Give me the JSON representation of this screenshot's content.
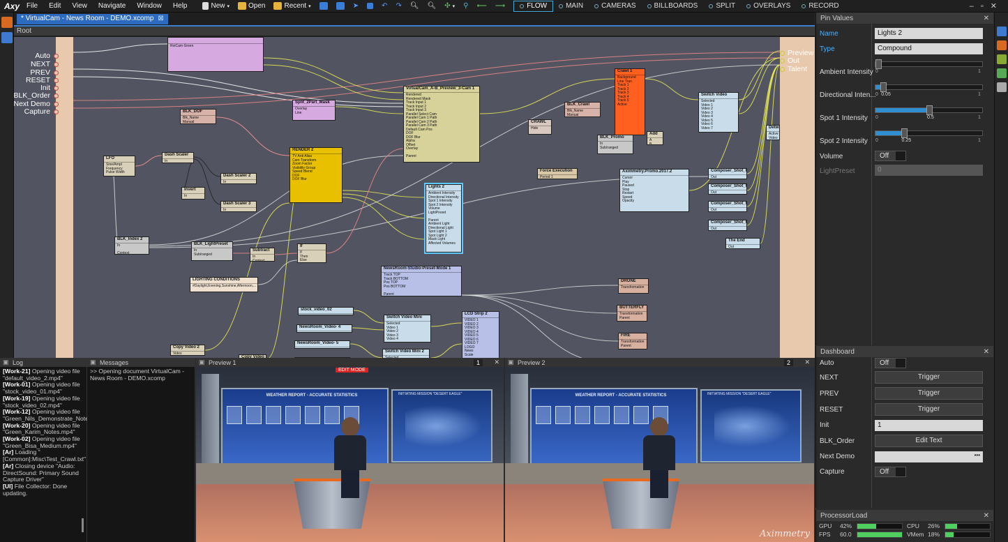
{
  "app": {
    "logo": "Axy",
    "menus": [
      "File",
      "Edit",
      "View",
      "Navigate",
      "Window",
      "Help"
    ],
    "toolbar": {
      "new": "New",
      "open": "Open",
      "recent": "Recent"
    },
    "modes": [
      "FLOW",
      "MAIN",
      "CAMERAS",
      "BILLBOARDS",
      "SPLIT",
      "OVERLAYS",
      "RECORD"
    ],
    "active_mode": "FLOW"
  },
  "doc": {
    "tab": "* VirtualCam - News Room - DEMO.xcomp",
    "breadcrumb": "Root"
  },
  "flow": {
    "inputs": [
      "Auto",
      "NEXT",
      "PREV",
      "RESET",
      "Init",
      "BLK_Order",
      "Next Demo",
      "Capture"
    ],
    "outputs": [
      "Preview",
      "Out",
      "Talent"
    ],
    "nodes": [
      {
        "id": "n_top",
        "title": "",
        "body": "RoiCam Green",
        "color": "#d6a9e0"
      },
      {
        "id": "n_vc",
        "title": "VirtualCam_A-B_Preview_3-Cam 1",
        "body": "Rendered\nRendered Mask\nTrack Input 1\nTrack Input 2\nTrack Input 3\nParallel Select Cam\nParallel Cam 1 Path\nParallel Cam 2 Path\nParallel Cam 3 Path\nDefault Cam Pos\nDOF\nDOF Blur\nAlpha\nOffset\nOverlay\n\nParent",
        "color": "#d6d29a"
      },
      {
        "id": "n_split",
        "title": "Split_2Part_Mask",
        "body": "Overlay\nLine",
        "color": "#d6a9e0"
      },
      {
        "id": "n_dof",
        "title": "BLK_DOF",
        "body": "Blk_Name\nManual",
        "color": "#d6b2a8"
      },
      {
        "id": "n_render",
        "title": "RENDER 2",
        "body": "TV Anti Alias\nCam Transform\nZoom Factor\nVisibility Group\nSpeed Blend\nDOF\nDOF Blur",
        "color": "#e8c000"
      },
      {
        "id": "n_lfo",
        "title": "LFO",
        "body": "Sine/Ampl\nFrequency\nPulse Width",
        "color": "#d8d0b8"
      },
      {
        "id": "n_dash",
        "title": "Dash Scaler",
        "body": "In",
        "color": "#d8d0b8"
      },
      {
        "id": "n_dash2",
        "title": "Dash Scaler 2",
        "body": "In",
        "color": "#d8d0b8"
      },
      {
        "id": "n_dash3",
        "title": "Dash Scaler 3",
        "body": "In",
        "color": "#d8d0b8"
      },
      {
        "id": "n_inv",
        "title": "Invert",
        "body": "In",
        "color": "#d8d0b8"
      },
      {
        "id": "n_crawl",
        "title": "Crawl 1",
        "body": "Background\nLine Tran\nTrack 1\nTrack 2\nTrack 3\nTrack 4\nTrack 5\nActive",
        "color": "#ff6020"
      },
      {
        "id": "n_crawlb",
        "title": "CRAWL",
        "body": "Hide",
        "color": "#d8c8c0"
      },
      {
        "id": "n_blkcrawl",
        "title": "BLK_Crawl",
        "body": "Blk_Name\nManual",
        "color": "#d6b2a8"
      },
      {
        "id": "n_blkpromo",
        "title": "BLK_Promo",
        "body": "In\nSub/ranged\n\nContext",
        "color": "#c8c8c8"
      },
      {
        "id": "n_add",
        "title": "Add",
        "body": "A\nB",
        "color": "#d8d0b8"
      },
      {
        "id": "n_sw",
        "title": "Switch Video",
        "body": "Selected\nVideo 1\nVideo 2\nVideo 3\nVideo 4\nVideo 5\nVideo 6\nVideo 7",
        "color": "#c8dcea"
      },
      {
        "id": "n_force",
        "title": "Force Execution",
        "body": "Period 1",
        "color": "#d8c8a8"
      },
      {
        "id": "n_promo",
        "title": "Aximmetry.Promo.2017.2",
        "body": "Cursor\nPlay\nPaused\nStop\nRestart\nSpeed\nOpacity",
        "color": "#c8dcea"
      },
      {
        "id": "n_cs1",
        "title": "Composer_Shot_01",
        "body": "Out",
        "color": "#c8dcea"
      },
      {
        "id": "n_cs2",
        "title": "Composer_Shot_02",
        "body": "Out",
        "color": "#c8dcea"
      },
      {
        "id": "n_cs3",
        "title": "Composer_Shot_03",
        "body": "Out",
        "color": "#c8dcea"
      },
      {
        "id": "n_cs4",
        "title": "Composer_Shot_04",
        "body": "Out",
        "color": "#c8dcea"
      },
      {
        "id": "n_end",
        "title": "The End",
        "body": "Out",
        "color": "#c8dcea"
      },
      {
        "id": "n_lights",
        "title": "Lights 2",
        "body": "Ambient Intensity\nDirectional Intensity\nSpot 1 Intensity\nSpot 2 Intensity\nVolume\nLightPreset\n\nParent\nAmbient Light\nDirectional Light\nSpot Light 1\nSpot Light 2\nMask Light\nAffected Volumes",
        "color": "#c8dcea"
      },
      {
        "id": "n_idx",
        "title": "BLK_Index 2",
        "body": "In\n\nContext",
        "color": "#c8c8c8"
      },
      {
        "id": "n_lp",
        "title": "BLK_LightPreset",
        "body": "In\nSub/ranged\n\nContext",
        "color": "#c8c8c8"
      },
      {
        "id": "n_sub",
        "title": "Subtract",
        "body": "In\nContext",
        "color": "#d8d0b8"
      },
      {
        "id": "n_if",
        "title": "If",
        "body": "If\nThen\nElse",
        "color": "#d8d0b8"
      },
      {
        "id": "n_lc",
        "title": "LIGHTING CONDITIONS",
        "body": "#Daylight,Evening,Sunshine,Afternoon,...",
        "color": "#f0e0d0"
      },
      {
        "id": "n_nrs",
        "title": "NewsRoom-Studio-Preset-Mode 1",
        "body": "Track TOP\nTrack BOTTOM\nPos TOP\nPos BOTTOM\n\nParent",
        "color": "#b8c0e8"
      },
      {
        "id": "n_drone",
        "title": "DRONE",
        "body": "Transformation",
        "color": "#d8b0a0"
      },
      {
        "id": "n_butterfly",
        "title": "BUTTERFLY",
        "body": "Transformation\nParent",
        "color": "#d8b0a0"
      },
      {
        "id": "n_fire",
        "title": "FIRE",
        "body": "Transformation\nParent",
        "color": "#d8b0a0"
      },
      {
        "id": "n_databars",
        "title": "DATA BARS",
        "body": "Transformation",
        "color": "#d8b0a0"
      },
      {
        "id": "n_sv2",
        "title": "stock_video_02",
        "body": "",
        "color": "#c8dcea"
      },
      {
        "id": "n_nv4",
        "title": "NewsRoom_Video- 4",
        "body": "",
        "color": "#c8dcea"
      },
      {
        "id": "n_nv5",
        "title": "NewsRoom_Video- 5",
        "body": "",
        "color": "#c8dcea"
      },
      {
        "id": "n_nv6",
        "title": "NewsRoom_Video- 6",
        "body": "",
        "color": "#c8dcea"
      },
      {
        "id": "n_swm",
        "title": "Switch Video Mini",
        "body": "Selected\nVideo 1\nVideo 2\nVideo 3\nVideo 4",
        "color": "#c8dcea"
      },
      {
        "id": "n_swm2",
        "title": "Switch Video Mini 2",
        "body": "Selected\nVideo 1\nVideo 2",
        "color": "#c8dcea"
      },
      {
        "id": "n_lcd",
        "title": "LCD Strip 2",
        "body": "VIDEO 1\nVIDEO 2\nVIDEO 3\nVIDEO 4\nVIDEO 5\nVIDEO 6\nVIDEO 7\nLOGO\nNews\nScale\n\nParent",
        "color": "#b8c0e8"
      },
      {
        "id": "n_copy2",
        "title": "Copy Video 2",
        "body": "Video",
        "color": "#d8d0b8"
      },
      {
        "id": "n_copy",
        "title": "Copy Video",
        "body": "Video",
        "color": "#d8d0b8"
      },
      {
        "id": "n_detw",
        "title": "Detwit",
        "body": "Active\nVideo",
        "color": "#c8dcea"
      }
    ]
  },
  "pin_values": {
    "title": "Pin Values",
    "name_label": "Name",
    "name_value": "Lights 2",
    "type_label": "Type",
    "type_value": "Compound",
    "sliders": [
      {
        "label": "Ambient Intensity",
        "value": 0,
        "min": "0",
        "max": "1",
        "shown": ""
      },
      {
        "label": "Directional Inten...",
        "value": 0.05,
        "min": "0",
        "max": "1",
        "shown": "0.05"
      },
      {
        "label": "Spot 1 Intensity",
        "value": 0.5,
        "min": "0",
        "max": "1",
        "shown": "0.5"
      },
      {
        "label": "Spot 2 Intensity",
        "value": 0.25,
        "min": "0",
        "max": "1",
        "shown": "0.25"
      }
    ],
    "volume_label": "Volume",
    "volume_value": "Off",
    "lightpreset_label": "LightPreset",
    "lightpreset_value": "0"
  },
  "dashboard": {
    "title": "Dashboard",
    "rows": [
      {
        "label": "Auto",
        "kind": "toggle",
        "value": "Off"
      },
      {
        "label": "NEXT",
        "kind": "button",
        "value": "Trigger"
      },
      {
        "label": "PREV",
        "kind": "button",
        "value": "Trigger"
      },
      {
        "label": "RESET",
        "kind": "button",
        "value": "Trigger"
      },
      {
        "label": "Init",
        "kind": "number",
        "value": "1"
      },
      {
        "label": "BLK_Order",
        "kind": "button",
        "value": "Edit Text"
      },
      {
        "label": "Next Demo",
        "kind": "text",
        "value": ""
      },
      {
        "label": "Capture",
        "kind": "toggle",
        "value": "Off"
      }
    ]
  },
  "processor": {
    "title": "ProcessorLoad",
    "stats": [
      {
        "label": "GPU",
        "value": "42%",
        "level": 0.42
      },
      {
        "label": "CPU",
        "value": "26%",
        "level": 0.26
      },
      {
        "label": "FPS",
        "value": "60.0",
        "level": 1.0
      },
      {
        "label": "VMem",
        "value": "18%",
        "level": 0.18
      }
    ]
  },
  "log": {
    "title": "Log",
    "lines": [
      {
        "tag": "[Work-21]",
        "text": " Opening video file \"default_video_2.mp4\""
      },
      {
        "tag": "[Work-01]",
        "text": " Opening video file \"stock_video_01.mp4\""
      },
      {
        "tag": "[Work-19]",
        "text": " Opening video file \"stock_video_02.mp4\""
      },
      {
        "tag": "[Work-12]",
        "text": " Opening video file \"Green_Nils_Demonstrate_Notes.mp4\""
      },
      {
        "tag": "[Work-20]",
        "text": " Opening video file \"Green_Karim_Notes.mp4\""
      },
      {
        "tag": "[Work-02]",
        "text": " Opening video file \"Green_Bisa_Medium.mp4\""
      },
      {
        "tag": "[Ar]",
        "text": " Loading \"[Common]:Misc\\Test_Crawl.txt\""
      },
      {
        "tag": "[Ar]",
        "text": " Closing device \"Audio: DirectSound: Primary Sound Capture Driver\""
      },
      {
        "tag": "[UI]",
        "text": " File Collector: Done updating."
      }
    ]
  },
  "messages": {
    "title": "Messages",
    "text": ">> Opening document VirtualCam - News Room - DEMO.xcomp"
  },
  "preview1": {
    "title": "Preview 1",
    "num": "1",
    "edit_mode": "EDIT MODE"
  },
  "preview2": {
    "title": "Preview 2",
    "num": "2"
  },
  "scene": {
    "headline": "WEATHER REPORT - ACCURATE STATISTICS",
    "mission": "INITIATING MISSION \"DESERT EAGLE\"",
    "watermark": "Aximmetry"
  }
}
